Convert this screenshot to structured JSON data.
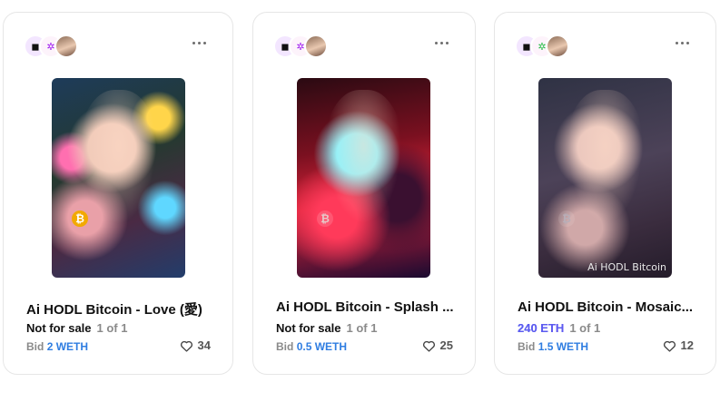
{
  "cards": [
    {
      "title": "Ai HODL Bitcoin - Love (愛)",
      "status": "Not for sale",
      "edition": "1 of 1",
      "bid_label": "Bid",
      "bid_amount": "2 WETH",
      "likes": "34",
      "watermark": ""
    },
    {
      "title": "Ai HODL Bitcoin - Splash ...",
      "status": "Not for sale",
      "edition": "1 of 1",
      "bid_label": "Bid",
      "bid_amount": "0.5 WETH",
      "likes": "25",
      "watermark": ""
    },
    {
      "title": "Ai HODL Bitcoin - Mosaic...",
      "status": "240 ETH",
      "edition": "1 of 1",
      "bid_label": "Bid",
      "bid_amount": "1.5 WETH",
      "likes": "12",
      "watermark": "Ai HODL Bitcoin"
    }
  ],
  "icons": {
    "more": "more-horizontal-icon",
    "heart": "heart-outline-icon",
    "bitcoin": "bitcoin-icon"
  },
  "colors": {
    "bid_amount": "#2f7de1",
    "price_gradient_start": "#3b6df2",
    "price_gradient_end": "#b545e8"
  }
}
